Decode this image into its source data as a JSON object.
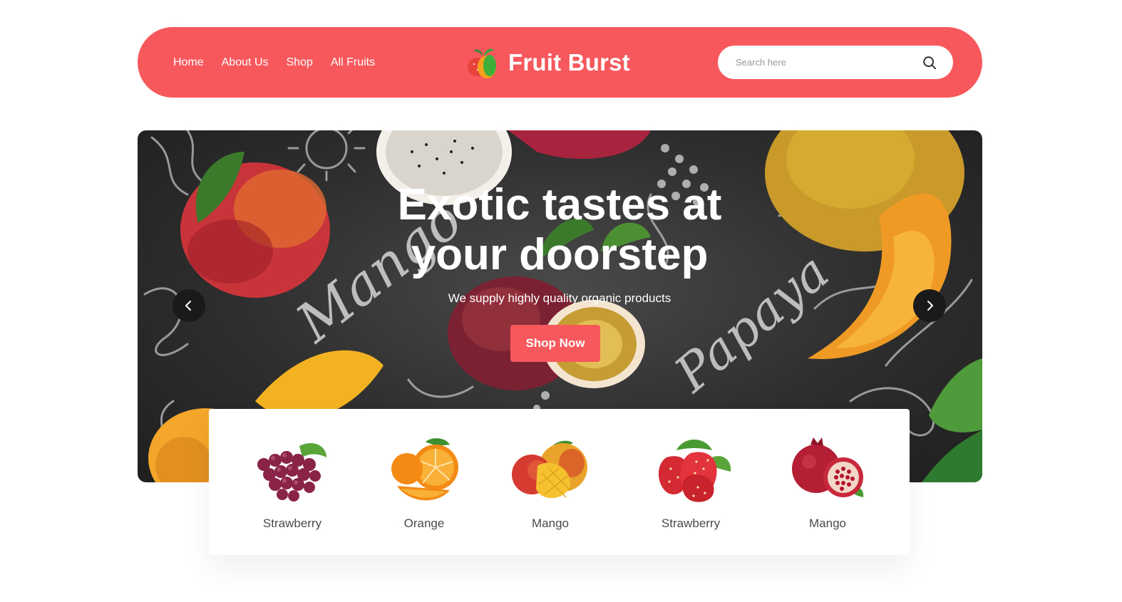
{
  "nav": {
    "links": [
      "Home",
      "About Us",
      "Shop",
      "All Fruits"
    ],
    "brand": "Fruit Burst",
    "search_placeholder": "Search here",
    "color": "#f7585c"
  },
  "hero": {
    "title": "Exotic tastes at your doorstep",
    "subtitle": "We supply highly quality organic products",
    "cta": "Shop Now",
    "lettering": [
      "Mango",
      "Papaya"
    ]
  },
  "categories": [
    {
      "label": "Strawberry",
      "icon": "grapes-icon"
    },
    {
      "label": "Orange",
      "icon": "orange-icon"
    },
    {
      "label": "Mango",
      "icon": "mango-icon"
    },
    {
      "label": "Strawberry",
      "icon": "strawberry-icon"
    },
    {
      "label": "Mango",
      "icon": "pomegranate-icon"
    }
  ]
}
